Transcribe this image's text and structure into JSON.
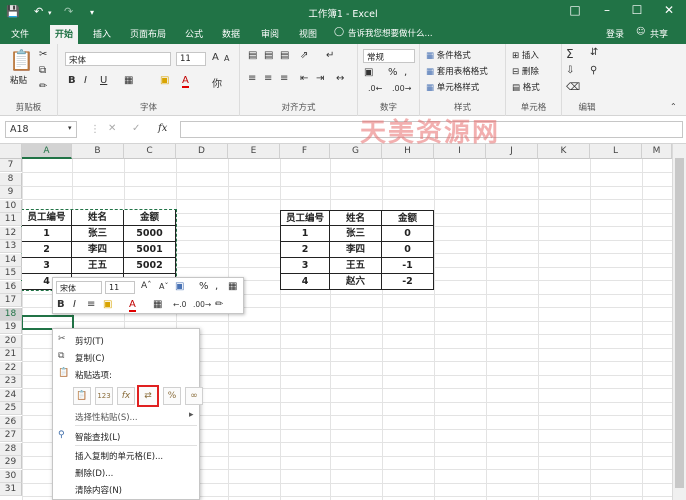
{
  "app": {
    "title": "工作簿1 - Excel",
    "tell_me": "告诉我您想要做什么...",
    "login": "登录",
    "share": "共享",
    "accent": "#217346"
  },
  "tabs": [
    {
      "label": "文件"
    },
    {
      "label": "开始"
    },
    {
      "label": "插入"
    },
    {
      "label": "页面布局"
    },
    {
      "label": "公式"
    },
    {
      "label": "数据"
    },
    {
      "label": "审阅"
    },
    {
      "label": "视图"
    }
  ],
  "ribbon": {
    "clipboard": {
      "label": "剪贴板",
      "paste": "粘贴"
    },
    "font": {
      "label": "字体",
      "name": "宋体",
      "size": "11",
      "bold": "B",
      "italic": "I",
      "underline": "U",
      "grow": "A",
      "shrink": "A",
      "color": "A"
    },
    "alignment": {
      "label": "对齐方式"
    },
    "number": {
      "label": "数字",
      "format": "常规",
      "percent": "%",
      "comma": ","
    },
    "styles": {
      "label": "样式",
      "items": [
        "条件格式",
        "套用表格格式",
        "单元格样式"
      ]
    },
    "cells": {
      "label": "单元格",
      "items": [
        "插入",
        "删除",
        "格式"
      ]
    },
    "editing": {
      "label": "编辑"
    }
  },
  "formula_bar": {
    "cell_ref": "A18",
    "fx": "fx",
    "value": ""
  },
  "watermark": "天美资源网",
  "grid": {
    "columns": [
      "A",
      "B",
      "C",
      "D",
      "E",
      "F",
      "G",
      "H",
      "I",
      "J",
      "K",
      "L",
      "M"
    ],
    "rows": [
      "7",
      "8",
      "9",
      "10",
      "11",
      "12",
      "13",
      "14",
      "15",
      "16",
      "17",
      "18",
      "19",
      "20",
      "21",
      "22",
      "23",
      "24",
      "25",
      "26",
      "27",
      "28",
      "29",
      "30",
      "31"
    ]
  },
  "table_left": {
    "headers": [
      "员工编号",
      "姓名",
      "金额"
    ],
    "rows": [
      [
        "1",
        "张三",
        "5000"
      ],
      [
        "2",
        "李四",
        "5001"
      ],
      [
        "3",
        "王五",
        "5002"
      ],
      [
        "4",
        "",
        ""
      ]
    ]
  },
  "table_right": {
    "headers": [
      "员工编号",
      "姓名",
      "金额"
    ],
    "rows": [
      [
        "1",
        "张三",
        "0"
      ],
      [
        "2",
        "李四",
        "0"
      ],
      [
        "3",
        "王五",
        "-1"
      ],
      [
        "4",
        "赵六",
        "-2"
      ]
    ]
  },
  "mini_toolbar": {
    "font": "宋体",
    "size": "11",
    "percent": "%",
    "comma": ","
  },
  "context_menu": {
    "cut": "剪切(T)",
    "copy": "复制(C)",
    "paste_options": "粘贴选项:",
    "paste_special": "选择性粘贴(S)...",
    "smart_lookup": "智能查找(L)",
    "insert_copied": "插入复制的单元格(E)...",
    "delete": "删除(D)...",
    "clear": "清除内容(N)"
  }
}
